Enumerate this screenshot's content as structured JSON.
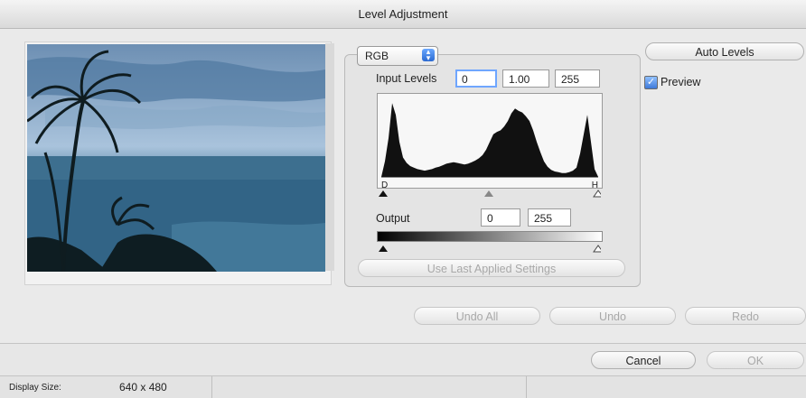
{
  "window": {
    "title": "Level Adjustment"
  },
  "channel": {
    "selected": "RGB"
  },
  "input_levels": {
    "label": "Input Levels",
    "black": "0",
    "gamma": "1.00",
    "white": "255"
  },
  "histogram": {
    "black_label": "D",
    "white_label": "H",
    "levels": [
      0,
      0.2,
      0.5,
      0.95,
      0.8,
      0.45,
      0.25,
      0.18,
      0.14,
      0.12,
      0.1,
      0.09,
      0.08,
      0.09,
      0.1,
      0.12,
      0.13,
      0.15,
      0.17,
      0.18,
      0.19,
      0.18,
      0.17,
      0.16,
      0.17,
      0.19,
      0.21,
      0.24,
      0.28,
      0.35,
      0.45,
      0.55,
      0.58,
      0.6,
      0.65,
      0.72,
      0.82,
      0.88,
      0.85,
      0.83,
      0.78,
      0.72,
      0.6,
      0.45,
      0.32,
      0.2,
      0.13,
      0.09,
      0.07,
      0.06,
      0.05,
      0.05,
      0.06,
      0.08,
      0.12,
      0.3,
      0.55,
      0.8,
      0.45,
      0.1,
      0
    ]
  },
  "output": {
    "label": "Output",
    "black": "0",
    "white": "255"
  },
  "buttons": {
    "auto_levels": "Auto Levels",
    "use_last": "Use Last Applied Settings",
    "undo_all": "Undo All",
    "undo": "Undo",
    "redo": "Redo",
    "cancel": "Cancel",
    "ok": "OK"
  },
  "preview": {
    "label": "Preview",
    "checked": true
  },
  "status": {
    "display_size_label": "Display Size:",
    "display_size_value": "640 x 480"
  }
}
